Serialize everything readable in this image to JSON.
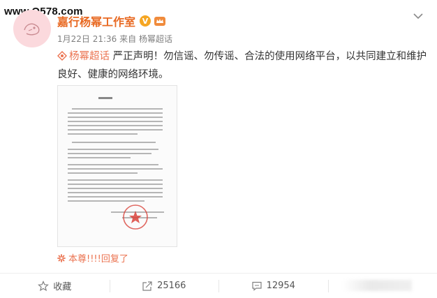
{
  "watermark": "www.Q578.com",
  "post": {
    "author": "嘉行杨幂工作室",
    "verified_badge": "V",
    "timestamp": "1月22日 21:36",
    "source_prefix": "来自",
    "source": "杨幂超话",
    "topic": "杨幂超话",
    "text": " 严正声明！勿信谣、勿传谣、合法的使用网络平台，以共同建立和维护良好、健康的网络环境。",
    "reply_text": "本尊!!!!回复了"
  },
  "actions": [
    {
      "icon": "star-icon",
      "label": "收藏"
    },
    {
      "icon": "share-icon",
      "label": "25166"
    },
    {
      "icon": "comment-icon",
      "label": "12954"
    }
  ],
  "colors": {
    "author": "#e86922",
    "accent": "#eb7350",
    "meta": "#808080",
    "stamp": "#d9433b"
  }
}
